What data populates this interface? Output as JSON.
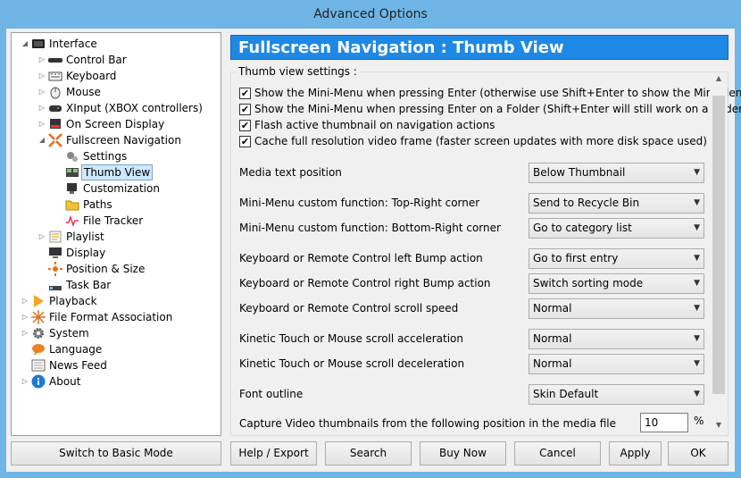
{
  "window": {
    "title": "Advanced Options"
  },
  "tree": [
    {
      "label": "Interface",
      "level": 0,
      "expander": "expanded",
      "icon": "interface-icon"
    },
    {
      "label": "Control Bar",
      "level": 1,
      "expander": "collapsed",
      "icon": "control-bar-icon"
    },
    {
      "label": "Keyboard",
      "level": 1,
      "expander": "collapsed",
      "icon": "keyboard-icon"
    },
    {
      "label": "Mouse",
      "level": 1,
      "expander": "collapsed",
      "icon": "mouse-icon"
    },
    {
      "label": "XInput (XBOX controllers)",
      "level": 1,
      "expander": "collapsed",
      "icon": "gamepad-icon"
    },
    {
      "label": "On Screen Display",
      "level": 1,
      "expander": "collapsed",
      "icon": "osd-icon"
    },
    {
      "label": "Fullscreen Navigation",
      "level": 1,
      "expander": "expanded",
      "icon": "fullscreen-icon"
    },
    {
      "label": "Settings",
      "level": 2,
      "expander": "none",
      "icon": "settings-icon"
    },
    {
      "label": "Thumb View",
      "level": 2,
      "expander": "none",
      "icon": "thumb-view-icon",
      "selected": true
    },
    {
      "label": "Customization",
      "level": 2,
      "expander": "none",
      "icon": "customization-icon"
    },
    {
      "label": "Paths",
      "level": 2,
      "expander": "none",
      "icon": "folder-icon"
    },
    {
      "label": "File Tracker",
      "level": 2,
      "expander": "none",
      "icon": "file-tracker-icon"
    },
    {
      "label": "Playlist",
      "level": 1,
      "expander": "collapsed",
      "icon": "playlist-icon"
    },
    {
      "label": "Display",
      "level": 1,
      "expander": "none",
      "icon": "display-icon"
    },
    {
      "label": "Position & Size",
      "level": 1,
      "expander": "none",
      "icon": "position-icon"
    },
    {
      "label": "Task Bar",
      "level": 1,
      "expander": "none",
      "icon": "task-bar-icon"
    },
    {
      "label": "Playback",
      "level": 0,
      "expander": "collapsed",
      "icon": "playback-icon"
    },
    {
      "label": "File Format Association",
      "level": 0,
      "expander": "collapsed",
      "icon": "file-format-icon"
    },
    {
      "label": "System",
      "level": 0,
      "expander": "collapsed",
      "icon": "gear-icon"
    },
    {
      "label": "Language",
      "level": 0,
      "expander": "none",
      "icon": "language-icon"
    },
    {
      "label": "News Feed",
      "level": 0,
      "expander": "none",
      "icon": "news-icon"
    },
    {
      "label": "About",
      "level": 0,
      "expander": "collapsed",
      "icon": "info-icon"
    }
  ],
  "header": {
    "title": "Fullscreen Navigation : Thumb View"
  },
  "group": {
    "legend": "Thumb view settings :"
  },
  "checkboxes": [
    {
      "label": "Show the Mini-Menu when pressing Enter (otherwise use Shift+Enter to show the Mini-Menu)",
      "checked": true
    },
    {
      "label": "Show the Mini-Menu when pressing Enter on a Folder (Shift+Enter will still work on a folder)",
      "checked": true
    },
    {
      "label": "Flash active thumbnail on navigation actions",
      "checked": true
    },
    {
      "label": "Cache full resolution video frame (faster screen updates with more disk space used)",
      "checked": true
    }
  ],
  "settings": [
    {
      "label": "Media text position",
      "value": "Below Thumbnail"
    },
    {
      "label": "Mini-Menu custom function: Top-Right corner",
      "value": "Send to Recycle Bin"
    },
    {
      "label": "Mini-Menu custom function: Bottom-Right corner",
      "value": "Go to category list"
    },
    {
      "label": "Keyboard or Remote Control left Bump action",
      "value": "Go to first entry"
    },
    {
      "label": "Keyboard or Remote Control right Bump action",
      "value": "Switch sorting mode"
    },
    {
      "label": "Keyboard or Remote Control scroll speed",
      "value": "Normal"
    },
    {
      "label": "Kinetic Touch or Mouse scroll acceleration",
      "value": "Normal"
    },
    {
      "label": "Kinetic Touch or Mouse scroll deceleration",
      "value": "Normal"
    },
    {
      "label": "Font outline",
      "value": "Skin Default"
    }
  ],
  "capture": {
    "label": "Capture Video thumbnails from the following position in the media file",
    "value": "10",
    "unit": "%"
  },
  "buttons": {
    "basic_mode": "Switch to Basic Mode",
    "help": "Help / Export",
    "search": "Search",
    "buy": "Buy Now",
    "cancel": "Cancel",
    "apply": "Apply",
    "ok": "OK"
  },
  "colors": {
    "header_bg": "#1e88e5",
    "frame": "#6eb5e6",
    "selection": "#cde8ff"
  }
}
